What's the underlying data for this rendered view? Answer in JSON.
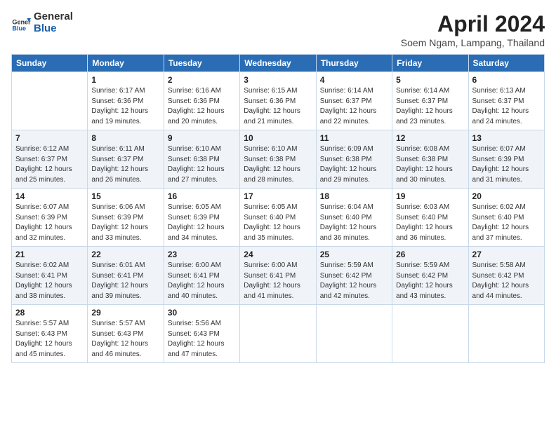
{
  "header": {
    "logo_general": "General",
    "logo_blue": "Blue",
    "title": "April 2024",
    "location": "Soem Ngam, Lampang, Thailand"
  },
  "weekdays": [
    "Sunday",
    "Monday",
    "Tuesday",
    "Wednesday",
    "Thursday",
    "Friday",
    "Saturday"
  ],
  "weeks": [
    [
      {
        "day": "",
        "info": ""
      },
      {
        "day": "1",
        "info": "Sunrise: 6:17 AM\nSunset: 6:36 PM\nDaylight: 12 hours\nand 19 minutes."
      },
      {
        "day": "2",
        "info": "Sunrise: 6:16 AM\nSunset: 6:36 PM\nDaylight: 12 hours\nand 20 minutes."
      },
      {
        "day": "3",
        "info": "Sunrise: 6:15 AM\nSunset: 6:36 PM\nDaylight: 12 hours\nand 21 minutes."
      },
      {
        "day": "4",
        "info": "Sunrise: 6:14 AM\nSunset: 6:37 PM\nDaylight: 12 hours\nand 22 minutes."
      },
      {
        "day": "5",
        "info": "Sunrise: 6:14 AM\nSunset: 6:37 PM\nDaylight: 12 hours\nand 23 minutes."
      },
      {
        "day": "6",
        "info": "Sunrise: 6:13 AM\nSunset: 6:37 PM\nDaylight: 12 hours\nand 24 minutes."
      }
    ],
    [
      {
        "day": "7",
        "info": "Sunrise: 6:12 AM\nSunset: 6:37 PM\nDaylight: 12 hours\nand 25 minutes."
      },
      {
        "day": "8",
        "info": "Sunrise: 6:11 AM\nSunset: 6:37 PM\nDaylight: 12 hours\nand 26 minutes."
      },
      {
        "day": "9",
        "info": "Sunrise: 6:10 AM\nSunset: 6:38 PM\nDaylight: 12 hours\nand 27 minutes."
      },
      {
        "day": "10",
        "info": "Sunrise: 6:10 AM\nSunset: 6:38 PM\nDaylight: 12 hours\nand 28 minutes."
      },
      {
        "day": "11",
        "info": "Sunrise: 6:09 AM\nSunset: 6:38 PM\nDaylight: 12 hours\nand 29 minutes."
      },
      {
        "day": "12",
        "info": "Sunrise: 6:08 AM\nSunset: 6:38 PM\nDaylight: 12 hours\nand 30 minutes."
      },
      {
        "day": "13",
        "info": "Sunrise: 6:07 AM\nSunset: 6:39 PM\nDaylight: 12 hours\nand 31 minutes."
      }
    ],
    [
      {
        "day": "14",
        "info": "Sunrise: 6:07 AM\nSunset: 6:39 PM\nDaylight: 12 hours\nand 32 minutes."
      },
      {
        "day": "15",
        "info": "Sunrise: 6:06 AM\nSunset: 6:39 PM\nDaylight: 12 hours\nand 33 minutes."
      },
      {
        "day": "16",
        "info": "Sunrise: 6:05 AM\nSunset: 6:39 PM\nDaylight: 12 hours\nand 34 minutes."
      },
      {
        "day": "17",
        "info": "Sunrise: 6:05 AM\nSunset: 6:40 PM\nDaylight: 12 hours\nand 35 minutes."
      },
      {
        "day": "18",
        "info": "Sunrise: 6:04 AM\nSunset: 6:40 PM\nDaylight: 12 hours\nand 36 minutes."
      },
      {
        "day": "19",
        "info": "Sunrise: 6:03 AM\nSunset: 6:40 PM\nDaylight: 12 hours\nand 36 minutes."
      },
      {
        "day": "20",
        "info": "Sunrise: 6:02 AM\nSunset: 6:40 PM\nDaylight: 12 hours\nand 37 minutes."
      }
    ],
    [
      {
        "day": "21",
        "info": "Sunrise: 6:02 AM\nSunset: 6:41 PM\nDaylight: 12 hours\nand 38 minutes."
      },
      {
        "day": "22",
        "info": "Sunrise: 6:01 AM\nSunset: 6:41 PM\nDaylight: 12 hours\nand 39 minutes."
      },
      {
        "day": "23",
        "info": "Sunrise: 6:00 AM\nSunset: 6:41 PM\nDaylight: 12 hours\nand 40 minutes."
      },
      {
        "day": "24",
        "info": "Sunrise: 6:00 AM\nSunset: 6:41 PM\nDaylight: 12 hours\nand 41 minutes."
      },
      {
        "day": "25",
        "info": "Sunrise: 5:59 AM\nSunset: 6:42 PM\nDaylight: 12 hours\nand 42 minutes."
      },
      {
        "day": "26",
        "info": "Sunrise: 5:59 AM\nSunset: 6:42 PM\nDaylight: 12 hours\nand 43 minutes."
      },
      {
        "day": "27",
        "info": "Sunrise: 5:58 AM\nSunset: 6:42 PM\nDaylight: 12 hours\nand 44 minutes."
      }
    ],
    [
      {
        "day": "28",
        "info": "Sunrise: 5:57 AM\nSunset: 6:43 PM\nDaylight: 12 hours\nand 45 minutes."
      },
      {
        "day": "29",
        "info": "Sunrise: 5:57 AM\nSunset: 6:43 PM\nDaylight: 12 hours\nand 46 minutes."
      },
      {
        "day": "30",
        "info": "Sunrise: 5:56 AM\nSunset: 6:43 PM\nDaylight: 12 hours\nand 47 minutes."
      },
      {
        "day": "",
        "info": ""
      },
      {
        "day": "",
        "info": ""
      },
      {
        "day": "",
        "info": ""
      },
      {
        "day": "",
        "info": ""
      }
    ]
  ]
}
